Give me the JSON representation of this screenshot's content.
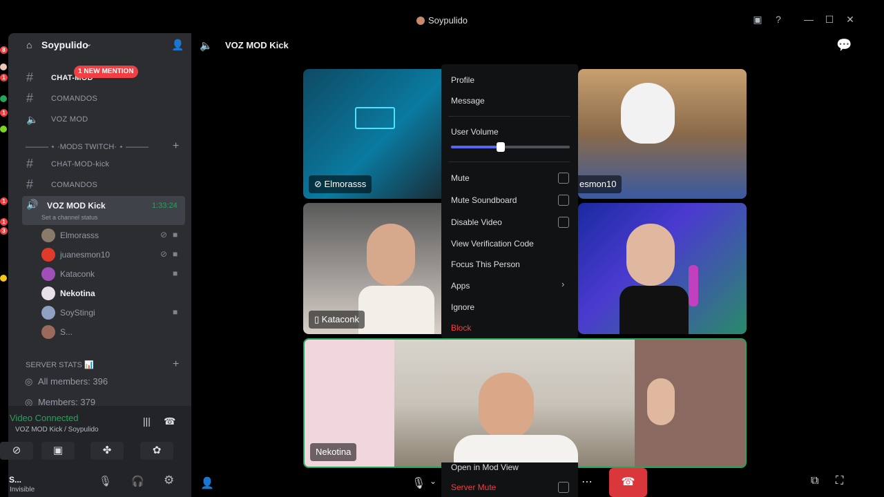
{
  "window": {
    "title": "Soypulido"
  },
  "server": {
    "name": "Soypulido"
  },
  "mention_badge": "1 NEW MENTION",
  "rail_badges": [
    "8",
    "1",
    "1",
    "1",
    "1",
    "3"
  ],
  "categories": [
    {
      "label": "——— ⋆ ·MODS TWITCH· ⋆ ———"
    },
    {
      "label": "SERVER STATS 📊"
    }
  ],
  "channels_top": [
    {
      "name": "CHAT-MOD"
    },
    {
      "name": "COMANDOS"
    },
    {
      "name": "VOZ MOD"
    }
  ],
  "channels_twitch": [
    {
      "name": "CHAT-MOD-kick"
    },
    {
      "name": "COMANDOS"
    }
  ],
  "voice_channel": {
    "name": "VOZ MOD Kick",
    "timer": "1:33:24",
    "status_placeholder": "Set a channel status"
  },
  "voice_users": [
    {
      "name": "Elmorasss",
      "color": "#8a7a6a"
    },
    {
      "name": "juanesmon10",
      "color": "#e03a2a"
    },
    {
      "name": "Kataconk",
      "color": "#a04fb8"
    },
    {
      "name": "Nekotina",
      "color": "#e8e0e8"
    },
    {
      "name": "SoyStingi",
      "color": "#8fa0c0"
    },
    {
      "name": "S...",
      "color": "#9a6a5a"
    }
  ],
  "stats": [
    {
      "label": "All members: 396"
    },
    {
      "label": "Members: 379"
    }
  ],
  "voice_panel": {
    "status": "Video Connected",
    "sub": "VOZ MOD Kick / Soypulido"
  },
  "user_panel": {
    "name": "S...",
    "status": "Invisible"
  },
  "main": {
    "channel_title": "VOZ MOD Kick"
  },
  "tiles": [
    {
      "label": "Elmorasss"
    },
    {
      "label": "esmon10"
    },
    {
      "label": "Kataconk"
    },
    {
      "label": ""
    },
    {
      "label": "Nekotina"
    }
  ],
  "context_menu": {
    "profile": "Profile",
    "message": "Message",
    "user_volume": "User Volume",
    "volume_fraction": 0.42,
    "mute": "Mute",
    "mute_soundboard": "Mute Soundboard",
    "disable_video": "Disable Video",
    "view_verification": "View Verification Code",
    "focus": "Focus This Person",
    "apps": "Apps",
    "ignore": "Ignore",
    "block": "Block",
    "open_mod_view": "Open in Mod View",
    "server_mute": "Server Mute"
  },
  "colors": {
    "accent": "#5865f2",
    "danger": "#f23f43",
    "connected": "#23a55a",
    "hangup": "#da373c"
  }
}
